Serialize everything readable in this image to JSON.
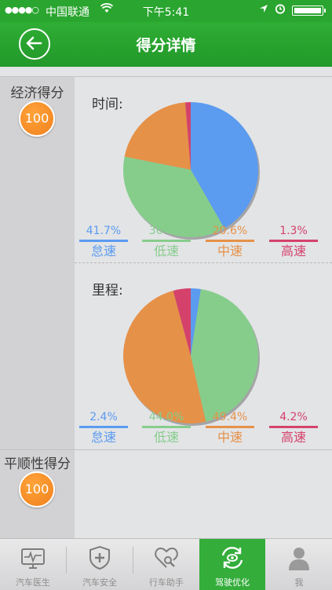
{
  "status_bar": {
    "signal": "●●●●○",
    "carrier": "中国联通",
    "time": "下午5:41"
  },
  "nav": {
    "title": "得分详情"
  },
  "economy": {
    "label": "经济得分",
    "score": "100"
  },
  "smoothness": {
    "label": "平顺性得分",
    "score": "100"
  },
  "colors": {
    "idle": "#5b9bf0",
    "low": "#86cd8c",
    "mid": "#e69148",
    "high": "#d4426c"
  },
  "chart_data": [
    {
      "type": "pie",
      "title": "时间:",
      "categories": [
        "怠速",
        "低速",
        "中速",
        "高速"
      ],
      "values": [
        41.7,
        36.4,
        20.6,
        1.3
      ],
      "labels": [
        "41.7%",
        "36.4%",
        "20.6%",
        "1.3%"
      ],
      "colors": [
        "#5b9bf0",
        "#86cd8c",
        "#e69148",
        "#d4426c"
      ]
    },
    {
      "type": "pie",
      "title": "里程:",
      "categories": [
        "怠速",
        "低速",
        "中速",
        "高速"
      ],
      "values": [
        2.4,
        44.0,
        49.4,
        4.2
      ],
      "labels": [
        "2.4%",
        "44.0%",
        "49.4%",
        "4.2%"
      ],
      "colors": [
        "#5b9bf0",
        "#86cd8c",
        "#e69148",
        "#d4426c"
      ]
    }
  ],
  "tabs": [
    {
      "label": "汽车医生",
      "icon": "monitor-heartbeat-icon",
      "active": false
    },
    {
      "label": "汽车安全",
      "icon": "shield-plus-icon",
      "active": false
    },
    {
      "label": "行车助手",
      "icon": "heart-search-icon",
      "active": false
    },
    {
      "label": "驾驶优化",
      "icon": "refresh-eye-icon",
      "active": true
    },
    {
      "label": "我",
      "icon": "user-icon",
      "active": false
    }
  ]
}
